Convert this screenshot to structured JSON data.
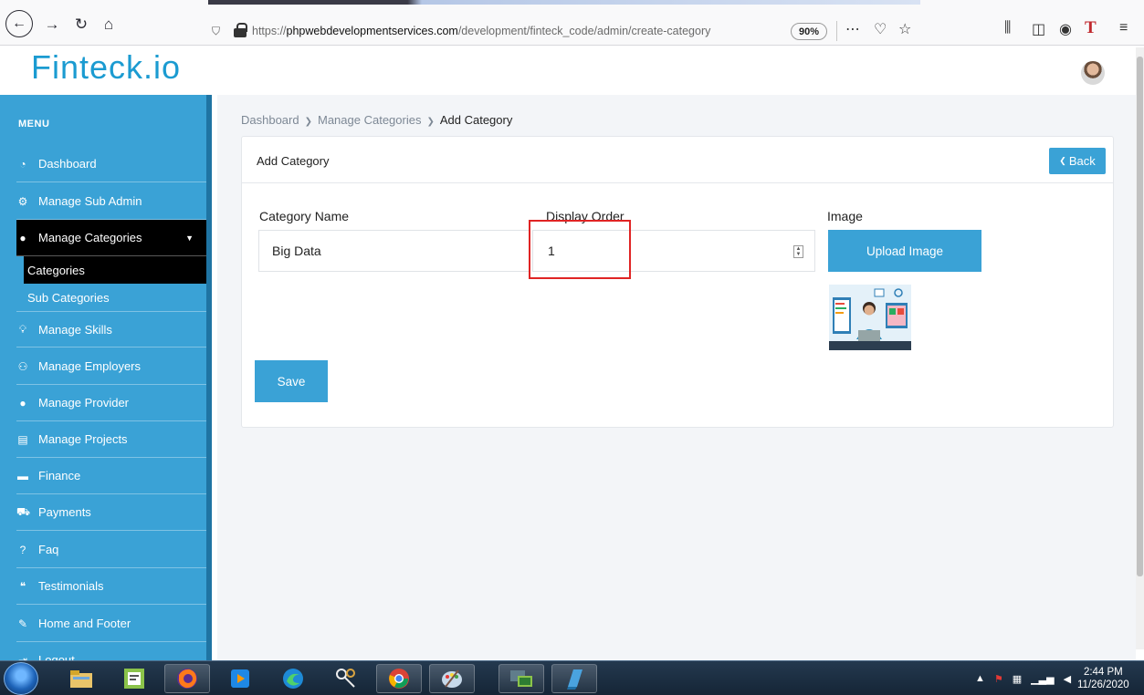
{
  "browser": {
    "url_prefix": "https://",
    "url_domain": "phpwebdevelopmentservices.com",
    "url_path": "/development/finteck_code/admin/create-category",
    "zoom": "90%",
    "icons": [
      "back-icon",
      "forward-icon",
      "reload-icon",
      "home-icon",
      "shield-icon",
      "lock-icon",
      "more-icon",
      "pocket-icon",
      "bookmark-star-icon",
      "library-icon",
      "sidebar-icon",
      "account-icon",
      "extension-t-icon",
      "menu-icon"
    ]
  },
  "header": {
    "logo": "Finteck.io"
  },
  "sidebar": {
    "menu_title": "MENU",
    "items": [
      {
        "label": "Dashboard",
        "icon": "dashboard-icon"
      },
      {
        "label": "Manage Sub Admin",
        "icon": "cogs-icon"
      },
      {
        "label": "Manage Categories",
        "icon": "user-icon"
      },
      {
        "label": "Manage Skills",
        "icon": "lightbulb-icon"
      },
      {
        "label": "Manage Employers",
        "icon": "users-icon"
      },
      {
        "label": "Manage Provider",
        "icon": "user-icon"
      },
      {
        "label": "Manage Projects",
        "icon": "list-icon"
      },
      {
        "label": "Finance",
        "icon": "money-icon"
      },
      {
        "label": "Payments",
        "icon": "cart-icon"
      },
      {
        "label": "Faq",
        "icon": "question-icon"
      },
      {
        "label": "Testimonials",
        "icon": "quote-icon"
      },
      {
        "label": "Home and Footer",
        "icon": "pencil-icon"
      },
      {
        "label": "Logout",
        "icon": "logout-icon"
      }
    ],
    "sub_items": [
      {
        "label": "Categories"
      },
      {
        "label": "Sub Categories"
      }
    ]
  },
  "breadcrumb": {
    "items": [
      "Dashboard",
      "Manage Categories",
      "Add Category"
    ]
  },
  "form": {
    "title": "Add Category",
    "back_label": "Back",
    "category_name_label": "Category Name",
    "category_name_value": "Big Data",
    "display_order_label": "Display Order",
    "display_order_value": "1",
    "image_label": "Image",
    "upload_label": "Upload Image",
    "save_label": "Save"
  },
  "taskbar": {
    "time": "2:44 PM",
    "date": "11/26/2020",
    "apps": [
      "windows-start-icon",
      "file-explorer-icon",
      "notepad-icon",
      "firefox-icon",
      "media-icon",
      "edge-icon",
      "keys-icon",
      "chrome-icon",
      "paint-icon",
      "remote-icon",
      "book-icon"
    ]
  },
  "colors": {
    "brand": "#1b9bd1",
    "sidebar": "#3aa2d6",
    "sidebar_border": "#1f74a3",
    "active_item": "#000000",
    "button": "#3aa2d6",
    "highlight": "#e02424"
  }
}
